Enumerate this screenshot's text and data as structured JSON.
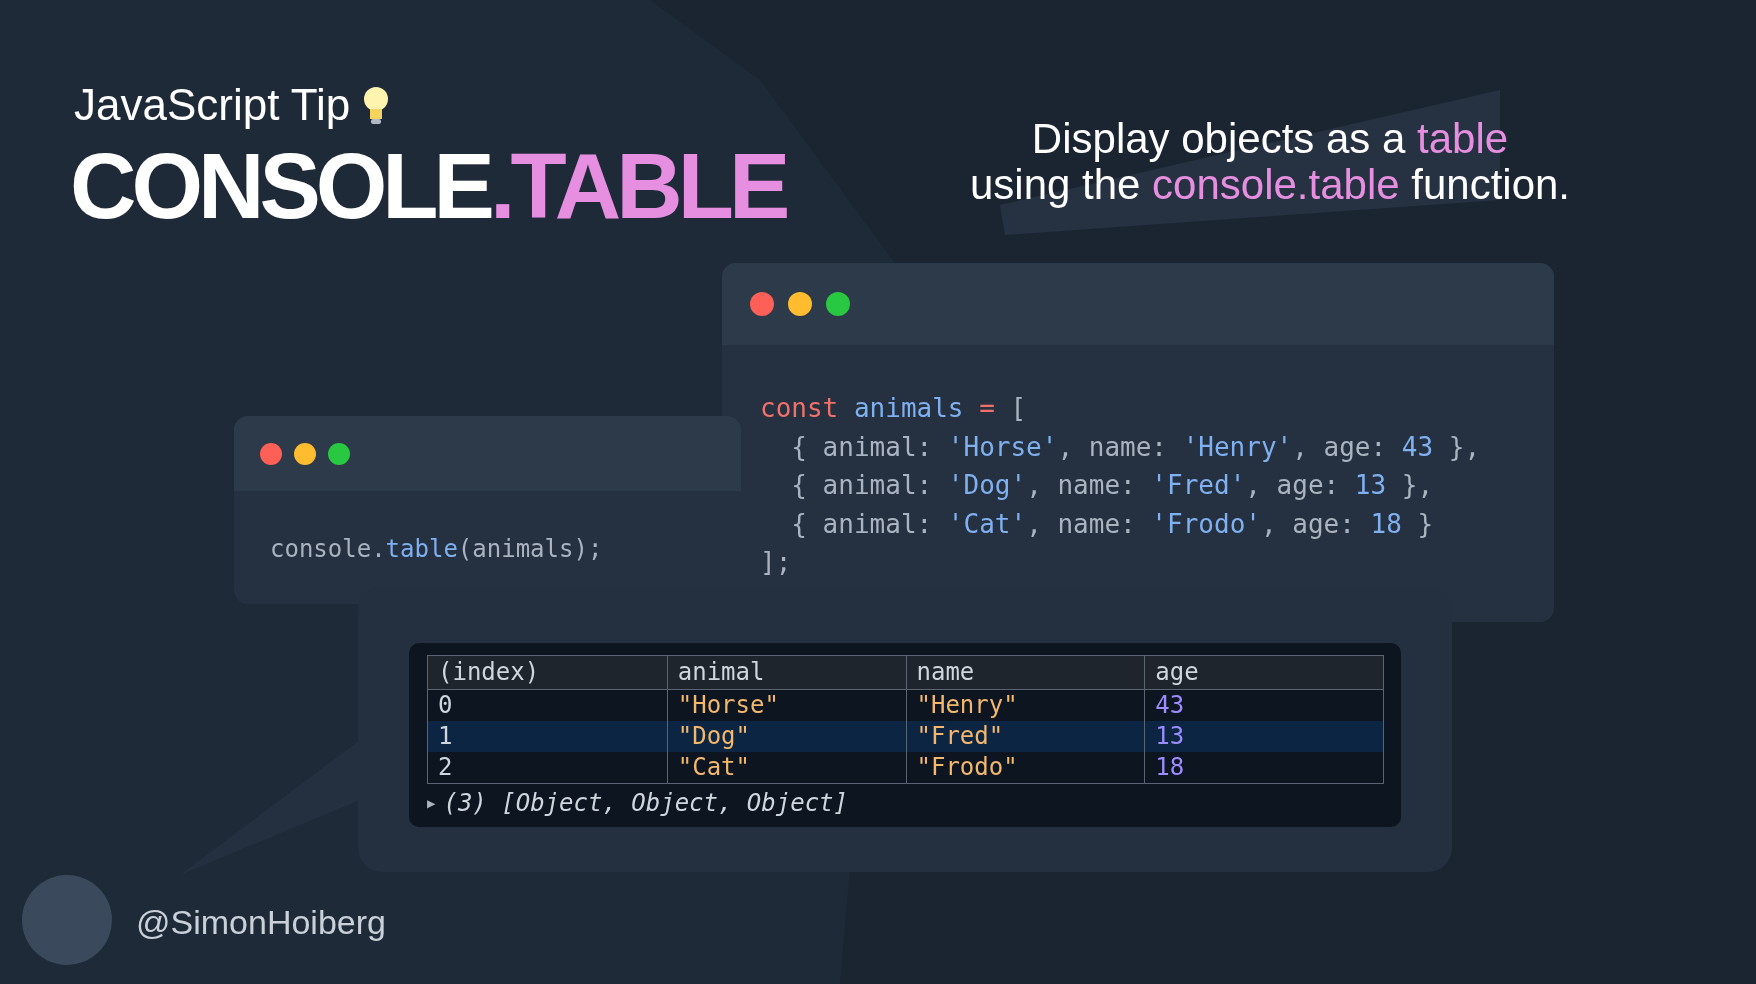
{
  "header": {
    "subtitle": "JavaScript Tip",
    "title": [
      {
        "text": "CONSOLE",
        "highlight": false
      },
      {
        "text": ".TABLE",
        "highlight": true
      }
    ]
  },
  "tagline": [
    [
      {
        "text": "Display objects as a ",
        "highlight": false
      },
      {
        "text": "table",
        "highlight": true
      }
    ],
    [
      {
        "text": "using the ",
        "highlight": false
      },
      {
        "text": "console.table",
        "highlight": true
      },
      {
        "text": " function.",
        "highlight": false
      }
    ]
  ],
  "code_window": {
    "lines": [
      [
        {
          "kind": "keyword",
          "text": "const "
        },
        {
          "kind": "name",
          "text": "animals "
        },
        {
          "kind": "keyword",
          "text": "="
        },
        {
          "kind": "plain",
          "text": " ["
        }
      ],
      [
        {
          "kind": "plain",
          "text": "  { animal: "
        },
        {
          "kind": "string",
          "text": "'Horse'"
        },
        {
          "kind": "plain",
          "text": ", name: "
        },
        {
          "kind": "string",
          "text": "'Henry'"
        },
        {
          "kind": "plain",
          "text": ", age: "
        },
        {
          "kind": "number",
          "text": "43"
        },
        {
          "kind": "plain",
          "text": " },"
        }
      ],
      [
        {
          "kind": "plain",
          "text": "  { animal: "
        },
        {
          "kind": "string",
          "text": "'Dog'"
        },
        {
          "kind": "plain",
          "text": ", name: "
        },
        {
          "kind": "string",
          "text": "'Fred'"
        },
        {
          "kind": "plain",
          "text": ", age: "
        },
        {
          "kind": "number",
          "text": "13"
        },
        {
          "kind": "plain",
          "text": " },"
        }
      ],
      [
        {
          "kind": "plain",
          "text": "  { animal: "
        },
        {
          "kind": "string",
          "text": "'Cat'"
        },
        {
          "kind": "plain",
          "text": ", name: "
        },
        {
          "kind": "string",
          "text": "'Frodo'"
        },
        {
          "kind": "plain",
          "text": ", age: "
        },
        {
          "kind": "number",
          "text": "18"
        },
        {
          "kind": "plain",
          "text": " }"
        }
      ],
      [
        {
          "kind": "plain",
          "text": "];"
        }
      ]
    ]
  },
  "call_window": {
    "lines": [
      [
        {
          "kind": "plain",
          "text": "console."
        },
        {
          "kind": "name",
          "text": "table"
        },
        {
          "kind": "plain",
          "text": "(animals);"
        }
      ]
    ]
  },
  "console": {
    "columns": [
      {
        "label": "(index)",
        "kind": "index"
      },
      {
        "label": "animal",
        "kind": "string"
      },
      {
        "label": "name",
        "kind": "string"
      },
      {
        "label": "age",
        "kind": "number"
      }
    ],
    "rows": [
      {
        "selected": false,
        "cells": [
          "0",
          "\"Horse\"",
          "\"Henry\"",
          "43"
        ]
      },
      {
        "selected": true,
        "cells": [
          "1",
          "\"Dog\"",
          "\"Fred\"",
          "13"
        ]
      },
      {
        "selected": false,
        "cells": [
          "2",
          "\"Cat\"",
          "\"Frodo\"",
          "18"
        ]
      }
    ],
    "summary": {
      "toggle": "▶",
      "text": "(3) [Object, Object, Object]"
    }
  },
  "author": {
    "handle": "@SimonHoiberg"
  }
}
